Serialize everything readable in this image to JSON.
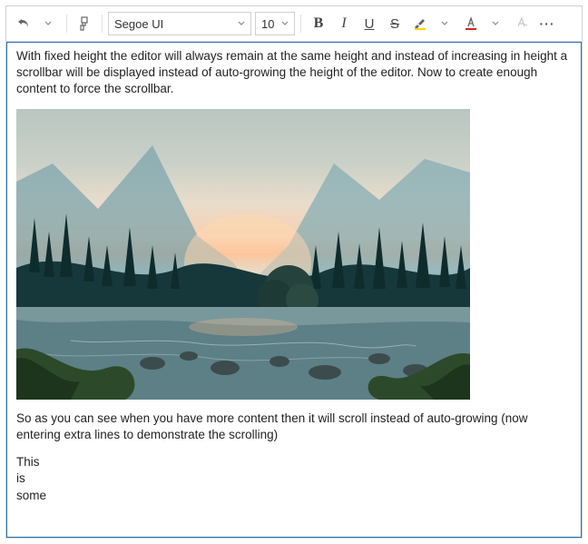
{
  "toolbar": {
    "font_family": "Segoe UI",
    "font_size": "10",
    "bold_label": "B",
    "italic_label": "I",
    "underline_label": "U",
    "strike_label": "S",
    "highlight_color": "#ffd400",
    "font_color_accent": "#cc2a1f",
    "more_label": "···"
  },
  "content": {
    "para1": "With fixed height the editor will always remain at the same height and instead of increasing in height a scrollbar will be displayed instead of auto-growing the height of the editor. Now to create enough content to force the scrollbar.",
    "para2": "So as you can see when you have more content then it will scroll instead of auto-growing (now entering extra lines to demonstrate the scrolling)",
    "line3": "This",
    "line4": "is",
    "line5": "some",
    "image_alt": "landscape-photo"
  }
}
